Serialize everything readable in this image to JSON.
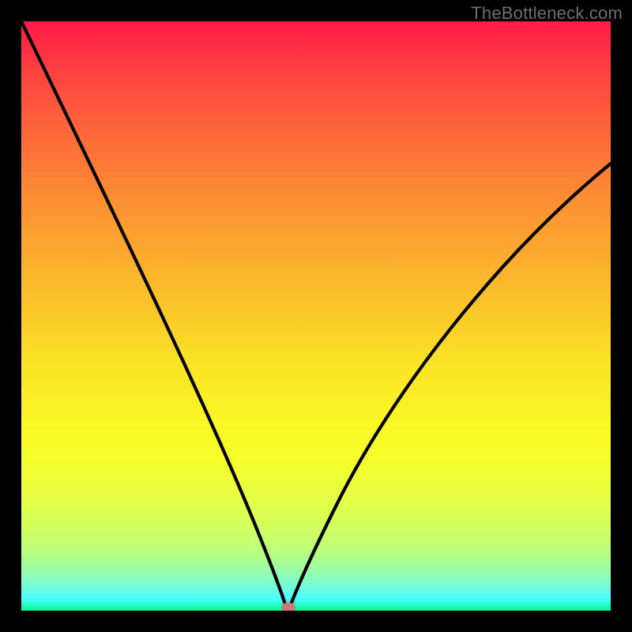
{
  "watermark": "TheBottleneck.com",
  "colors": {
    "frame_bg": "#000000",
    "curve_stroke": "#000000",
    "marker_fill": "#cb7a74",
    "gradient_top": "#fe1b48",
    "gradient_bottom": "#02fb8b"
  },
  "chart_data": {
    "type": "line",
    "title": "",
    "xlabel": "",
    "ylabel": "",
    "xlim": [
      0,
      100
    ],
    "ylim": [
      0,
      100
    ],
    "grid": false,
    "x": [
      0,
      5,
      10,
      15,
      20,
      25,
      30,
      35,
      40,
      43,
      45,
      47,
      50,
      55,
      60,
      65,
      70,
      75,
      80,
      85,
      90,
      95,
      100
    ],
    "values": [
      100,
      88,
      77,
      65,
      54,
      43,
      31,
      20,
      9,
      2,
      0,
      2,
      9,
      20,
      30,
      38,
      45,
      52,
      58,
      63,
      68,
      72,
      76
    ],
    "marker": {
      "x": 45,
      "y": 0.5
    },
    "annotations": []
  }
}
